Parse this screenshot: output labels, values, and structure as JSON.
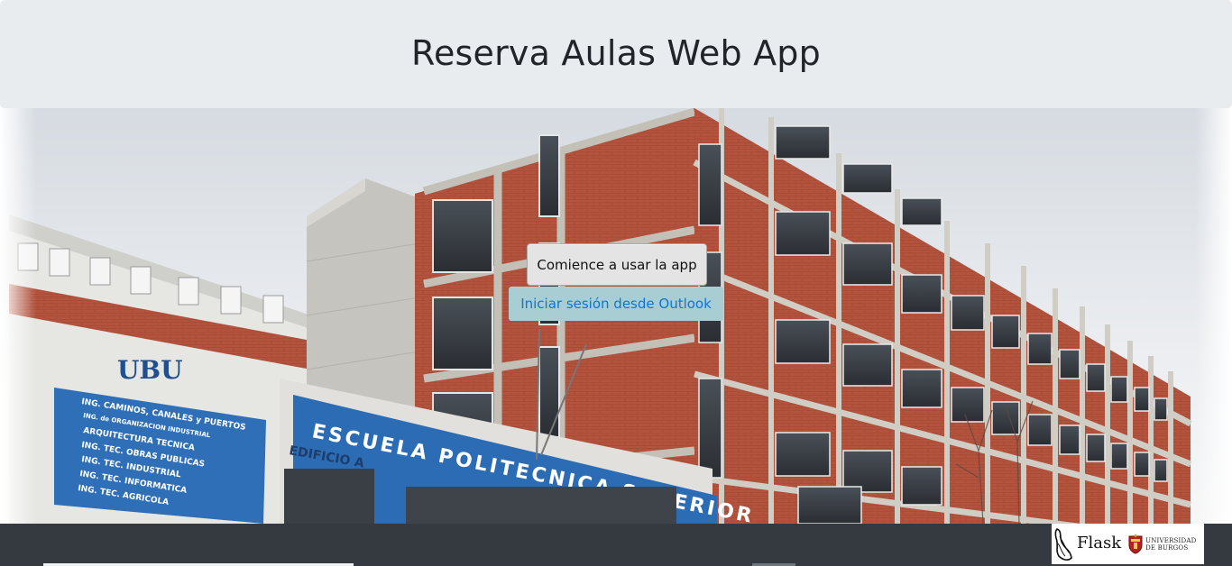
{
  "header": {
    "title": "Reserva Aulas Web App"
  },
  "hero": {
    "image_description_icon": "building-photo",
    "sign_ubu": "UBU",
    "sign_escuela": "ESCUELA POLITECNICA SUPERIOR",
    "sign_edificio": "EDIFICIO A",
    "sign_board_lines": [
      "ING. CAMINOS, CANALES y PUERTOS",
      "ING. de ORGANIZACION INDUSTRIAL",
      "ARQUITECTURA TECNICA",
      "ING. TEC. OBRAS PUBLICAS",
      "ING. TEC. INDUSTRIAL",
      "ING. TEC. INFORMATICA",
      "ING. TEC. AGRICOLA"
    ]
  },
  "actions": {
    "start_label": "Comience a usar la app",
    "outlook_label": "Iniciar sesión desde Outlook"
  },
  "footer": {
    "flask_label": "Flask",
    "ubu_line1": "UNIVERSIDAD",
    "ubu_line2": "DE BURGOS"
  },
  "colors": {
    "header_bg": "#e9ecef",
    "footer_bg": "#343a40",
    "outlook_bg": "#a8ced3",
    "outlook_text": "#0e74d8",
    "brick": "#b5553f"
  }
}
